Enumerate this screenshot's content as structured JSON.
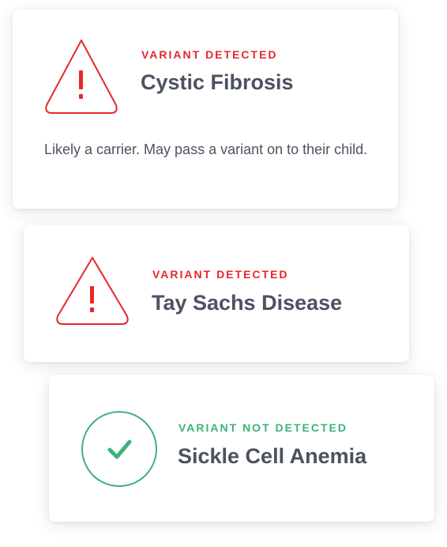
{
  "colors": {
    "alert": "#e8262b",
    "success": "#3eb27a",
    "title_text": "#4c5260"
  },
  "results": [
    {
      "status": "VARIANT DETECTED",
      "condition": "Cystic Fibrosis",
      "description": "Likely a carrier. May pass a variant on to their child.",
      "icon": "warning-triangle-icon"
    },
    {
      "status": "VARIANT DETECTED",
      "condition": "Tay Sachs Disease",
      "icon": "warning-triangle-icon"
    },
    {
      "status": "VARIANT NOT DETECTED",
      "condition": "Sickle Cell Anemia",
      "icon": "check-circle-icon"
    }
  ]
}
